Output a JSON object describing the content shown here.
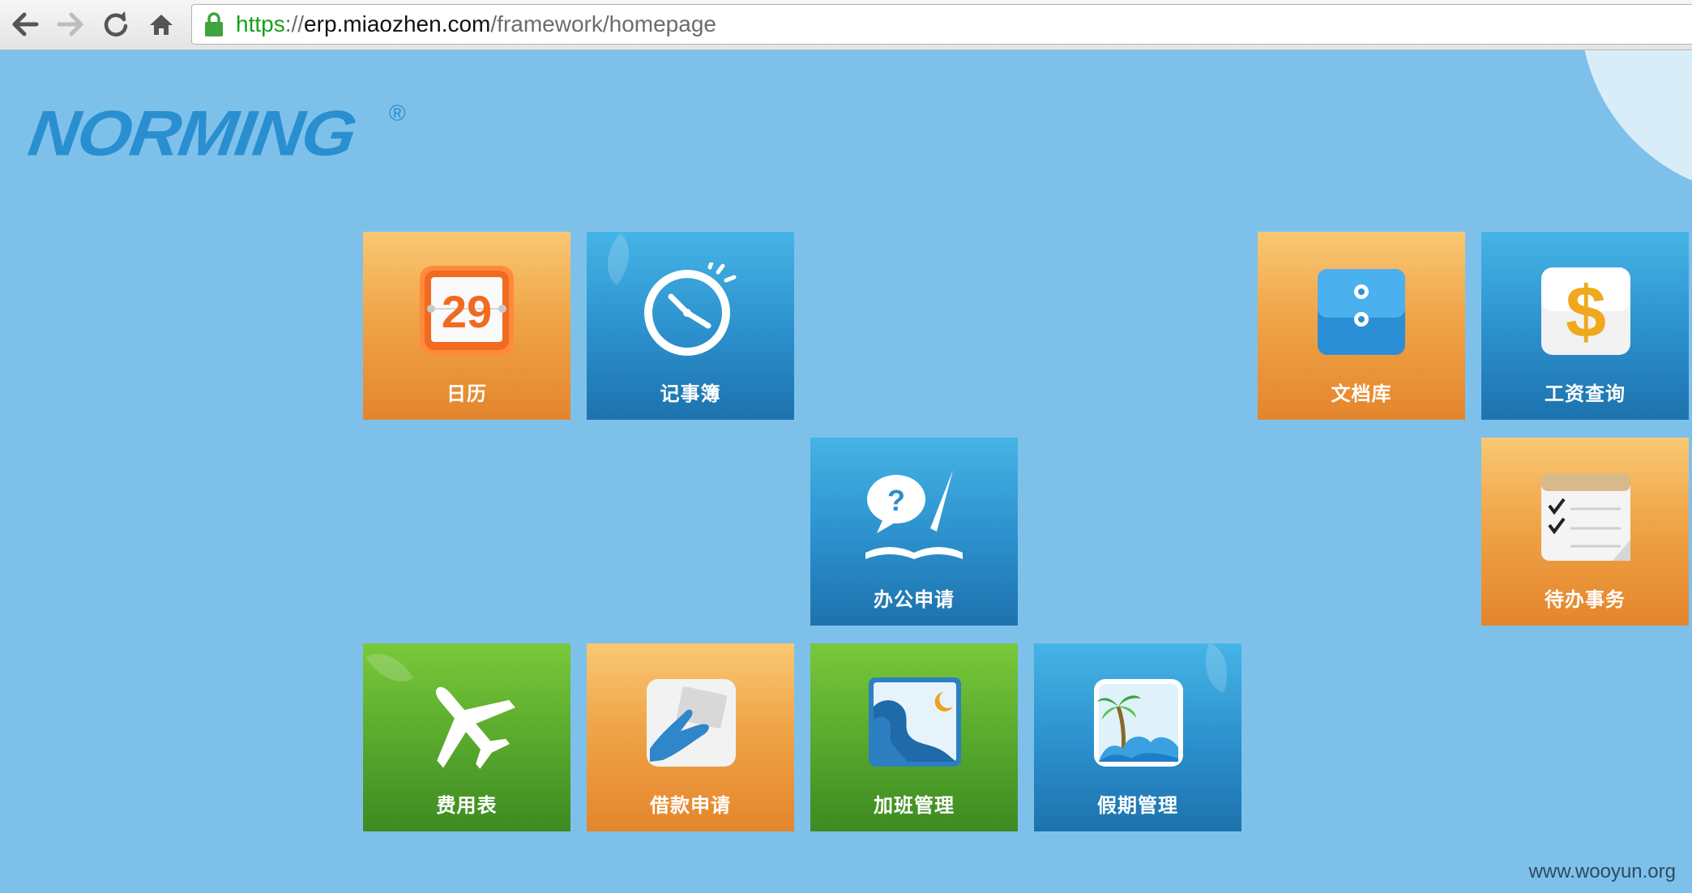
{
  "browser": {
    "url_scheme": "https",
    "url_sep": "://",
    "url_host": "erp.miaozhen.com",
    "url_path": "/framework/homepage"
  },
  "logo": {
    "text": "NORMING",
    "mark": "®"
  },
  "tiles": [
    {
      "label": "日历",
      "color": "orange",
      "icon": "calendar-icon",
      "day": "29"
    },
    {
      "label": "记事簿",
      "color": "blue",
      "icon": "clock-icon"
    },
    {
      "label": "文档库",
      "color": "orange",
      "icon": "folder-icon"
    },
    {
      "label": "工资查询",
      "color": "blue",
      "icon": "dollar-icon",
      "symbol": "$"
    },
    {
      "label": "办公申请",
      "color": "blue",
      "icon": "question-book-icon",
      "symbol": "?"
    },
    {
      "label": "待办事务",
      "color": "orange",
      "icon": "checklist-icon"
    },
    {
      "label": "费用表",
      "color": "green",
      "icon": "airplane-icon"
    },
    {
      "label": "借款申请",
      "color": "orange",
      "icon": "hand-card-icon"
    },
    {
      "label": "加班管理",
      "color": "green",
      "icon": "night-person-icon"
    },
    {
      "label": "假期管理",
      "color": "blue",
      "icon": "palm-tree-icon"
    }
  ],
  "watermark": "www.wooyun.org"
}
